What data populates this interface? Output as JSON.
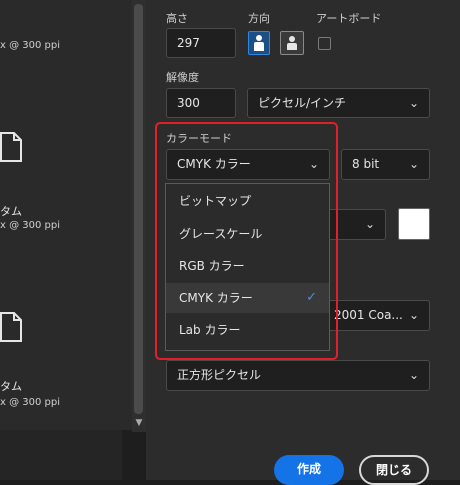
{
  "presets": [
    {
      "name": "",
      "size": "x @ 300 ppi"
    },
    {
      "name": "タム",
      "size": "x @ 300 ppi"
    },
    {
      "name": "タム",
      "size": "x @ 300 ppi"
    }
  ],
  "height": {
    "label": "高さ",
    "value": "297"
  },
  "orientation": {
    "label": "方向"
  },
  "artboard": {
    "label": "アートボード"
  },
  "resolution": {
    "label": "解像度",
    "value": "300",
    "unit": "ピクセル/インチ"
  },
  "color_mode": {
    "label": "カラーモード",
    "value": "CMYK カラー",
    "bit_depth": "8 bit"
  },
  "color_mode_menu": {
    "items": [
      "ビットマップ",
      "グレースケール",
      "RGB カラー",
      "CMYK カラー",
      "Lab カラー"
    ],
    "selected": "CMYK カラー"
  },
  "background_swatch": "#ffffff",
  "color_profile": {
    "value": "2001 Coa..."
  },
  "pixel_aspect": {
    "value": "正方形ピクセル"
  },
  "buttons": {
    "create": "作成",
    "close": "閉じる"
  },
  "colors": {
    "accent": "#1473e6",
    "highlight": "#e0202a",
    "check": "#4a90e2"
  }
}
